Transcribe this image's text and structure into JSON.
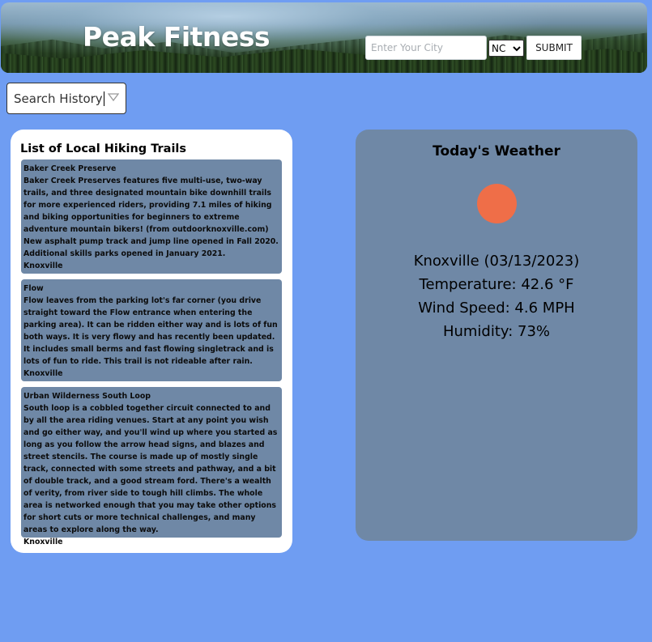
{
  "header": {
    "brand": "Peak Fitness",
    "city_placeholder": "Enter Your City",
    "state_selected": "NC",
    "submit_label": "SUBMIT"
  },
  "history": {
    "label": "Search History"
  },
  "trails": {
    "title": "List of Local Hiking Trails",
    "items": [
      {
        "name": "Baker Creek Preserve",
        "description": "Baker Creek Preserves features five multi-use, two-way trails, and three designated mountain bike downhill trails for more experienced riders, providing 7.1 miles of hiking and biking opportunities for beginners to extreme adventure mountain bikers! (from outdoorknoxville.com) New asphalt pump track and jump line opened in Fall 2020. Additional skills parks opened in January 2021.",
        "city": "Knoxville"
      },
      {
        "name": "Flow",
        "description": "Flow leaves from the parking lot's far corner (you drive straight toward the Flow entrance when entering the parking area). It can be ridden either way and is lots of fun both ways. It is very flowy and has recently been updated. It includes small berms and fast flowing singletrack and is lots of fun to ride. This trail is not rideable after rain.",
        "city": "Knoxville"
      },
      {
        "name": "Urban Wilderness South Loop",
        "description": "South loop is a cobbled together circuit connected to and by all the area riding venues. Start at any point you wish and go either way, and you'll wind up where you started as long as you follow the arrow head signs, and blazes and street stencils. The course is made up of mostly single track, connected with some streets and pathway, and a bit of double track, and a good stream ford. There's a wealth of verity, from river side to tough hill climbs. The whole area is networked enough that you may take other options for short cuts or more technical challenges, and many areas to explore along the way.",
        "city": "Knoxville"
      }
    ]
  },
  "weather": {
    "title": "Today's Weather",
    "icon": "sun-icon",
    "city_date": "Knoxville (03/13/2023)",
    "temperature": "Temperature: 42.6 °F",
    "wind": "Wind Speed: 4.6 MPH",
    "humidity": "Humidity: 73%"
  },
  "colors": {
    "page_background": "#6f9df2",
    "card_slate": "#6f88a6",
    "sun": "#ef6e48"
  }
}
